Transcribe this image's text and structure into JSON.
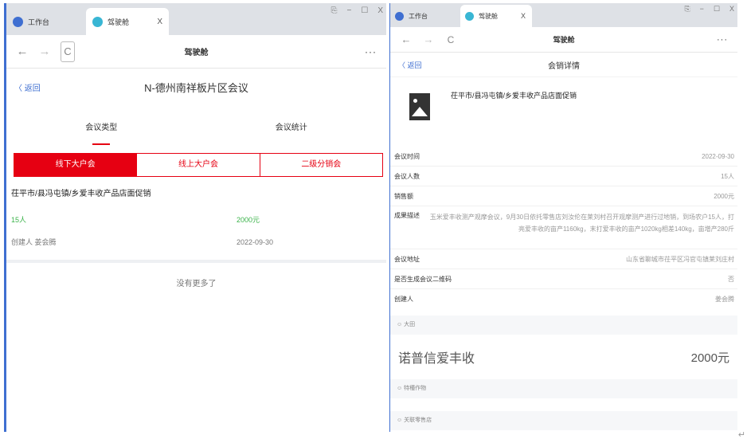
{
  "colors": {
    "accent": "#e60012",
    "link": "#3f6fd1",
    "green": "#3bb34a"
  },
  "left": {
    "tabs": [
      {
        "label": "工作台",
        "icon": "globe-icon"
      },
      {
        "label": "驾驶舱",
        "icon": "app-logo-icon",
        "close": "X"
      }
    ],
    "window_controls": [
      "⎘",
      "−",
      "☐",
      "X"
    ],
    "nav": {
      "back": "←",
      "forward": "→",
      "refresh": "C",
      "title": "驾驶舱",
      "more": "···"
    },
    "header": {
      "back": "〈 返回",
      "title": "N-德州南祥板片区会议"
    },
    "tabs_meeting": [
      {
        "label": "会议类型"
      },
      {
        "label": "会议统计"
      }
    ],
    "segments": [
      {
        "label": "线下大户会"
      },
      {
        "label": "线上大户会"
      },
      {
        "label": "二级分销会"
      }
    ],
    "card": {
      "title": "茌平市/县冯屯镇/乡爱丰收产品店面促销",
      "people": "15人",
      "amount": "2000元",
      "creator": "创建人 姜会腾",
      "date": "2022-09-30"
    },
    "no_more": "没有更多了"
  },
  "right": {
    "tabs": [
      {
        "label": "工作台",
        "icon": "globe-icon"
      },
      {
        "label": "驾驶舱",
        "icon": "app-logo-icon",
        "close": "X"
      }
    ],
    "window_controls": [
      "⎘",
      "−",
      "☐",
      "X"
    ],
    "nav": {
      "back": "←",
      "forward": "→",
      "refresh": "C",
      "title": "驾驶舱",
      "more": "···"
    },
    "header": {
      "back": "〈 返回",
      "title": "会销详情"
    },
    "product_title": "茌平市/县冯屯镇/乡爱丰收产品店面促销",
    "details": [
      {
        "key": "会议时间",
        "value": "2022-09-30"
      },
      {
        "key": "会议人数",
        "value": "15人"
      },
      {
        "key": "销售额",
        "value": "2000元"
      },
      {
        "key": "成果描述",
        "value": "玉米爱丰收测产观摩会议，9月30日依托零售店刘汝伦在莱刘村召开观摩测产进行过地销，到场农户15人，打亮爱丰收的亩产1160kg，末打爱丰收的亩产1020kg相差140kg，亩增产280斤"
      },
      {
        "key": "会议地址",
        "value": "山东省聊城市茌平区冯官屯镇莱刘庄村"
      },
      {
        "key": "是否生成会议二维码",
        "value": "否"
      },
      {
        "key": "创建人",
        "value": "姜会腾"
      }
    ],
    "section1": "☺ 大田",
    "product_name": "诺普信爱丰收",
    "product_amount": "2000元",
    "section2": "☺ 特種作物",
    "section3": "☺ 关联零售店"
  },
  "ret_mark": "↵"
}
